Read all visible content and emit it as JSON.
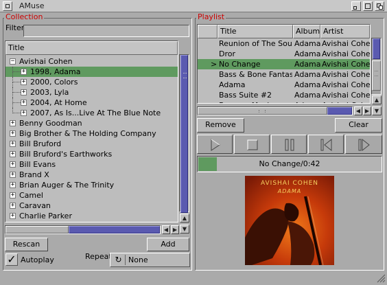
{
  "window": {
    "title": "AMuse"
  },
  "collection": {
    "label": "Collection",
    "filter_label": "Filter",
    "filter_value": "",
    "column_title": "Title",
    "tree": [
      {
        "label": "Avishai Cohen",
        "expander": "−",
        "level": 0
      },
      {
        "label": "1998, Adama",
        "expander": "+",
        "level": 1,
        "selected": true
      },
      {
        "label": "2000, Colors",
        "expander": "+",
        "level": 1
      },
      {
        "label": "2003, Lyla",
        "expander": "+",
        "level": 1
      },
      {
        "label": "2004, At Home",
        "expander": "+",
        "level": 1
      },
      {
        "label": "2007, As Is...Live At The Blue Note",
        "expander": "+",
        "level": 1
      },
      {
        "label": "Benny Goodman",
        "expander": "+",
        "level": 0
      },
      {
        "label": "Big Brother & The Holding Company",
        "expander": "+",
        "level": 0
      },
      {
        "label": "Bill Bruford",
        "expander": "+",
        "level": 0
      },
      {
        "label": "Bill Bruford's Earthworks",
        "expander": "+",
        "level": 0
      },
      {
        "label": "Bill Evans",
        "expander": "+",
        "level": 0
      },
      {
        "label": "Brand X",
        "expander": "+",
        "level": 0
      },
      {
        "label": "Brian Auger & The Trinity",
        "expander": "+",
        "level": 0
      },
      {
        "label": "Camel",
        "expander": "+",
        "level": 0
      },
      {
        "label": "Caravan",
        "expander": "+",
        "level": 0
      },
      {
        "label": "Charlie Parker",
        "expander": "+",
        "level": 0
      }
    ],
    "rescan_label": "Rescan",
    "add_label": "Add",
    "autoplay_label": "Autoplay",
    "autoplay_checked": true,
    "repeat_label": "Repeat",
    "repeat_value": "None"
  },
  "playlist": {
    "label": "Playlist",
    "columns": [
      "Title",
      "Album",
      "Artist"
    ],
    "rows": [
      {
        "marker": "",
        "title": "Reunion of The Souls",
        "album": "Adama",
        "artist": "Avishai Cohen"
      },
      {
        "marker": "",
        "title": "Dror",
        "album": "Adama",
        "artist": "Avishai Cohen"
      },
      {
        "marker": ">",
        "title": "No Change",
        "album": "Adama",
        "artist": "Avishai Cohen",
        "selected": true
      },
      {
        "marker": "",
        "title": "Bass & Bone Fantasy",
        "album": "Adama",
        "artist": "Avishai Cohen"
      },
      {
        "marker": "",
        "title": "Adama",
        "album": "Adama",
        "artist": "Avishai Cohen"
      },
      {
        "marker": "",
        "title": "Bass Suite #2",
        "album": "Adama",
        "artist": "Avishai Cohen"
      },
      {
        "marker": "",
        "title": "Besame Mucho",
        "album": "Adama",
        "artist": "Avishai Cohen"
      }
    ],
    "remove_label": "Remove",
    "clear_label": "Clear",
    "now_playing": "No Change/0:42",
    "progress_fraction": 0.1,
    "cover": {
      "artist_text": "AVISHAI COHEN",
      "album_text": "ADAMA"
    }
  },
  "colors": {
    "selection": "#5f9a5f",
    "accent_label": "#cc0000",
    "scroll_thumb": "#5a5ab0"
  }
}
